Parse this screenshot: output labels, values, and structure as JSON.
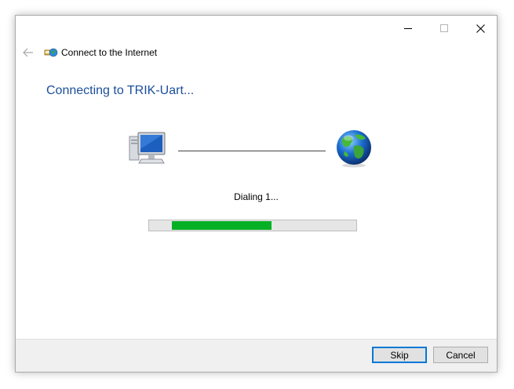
{
  "window": {
    "title": "Connect to the Internet",
    "heading": "Connecting to TRIK-Uart..."
  },
  "caption_buttons": {
    "minimize_icon": "minimize-icon",
    "maximize_icon": "maximize-icon",
    "close_icon": "close-icon"
  },
  "status": {
    "text": "Dialing 1...",
    "progress_start_fraction": 0.11,
    "progress_end_fraction": 0.59,
    "progress_color": "#06b025"
  },
  "buttons": {
    "skip": "Skip",
    "cancel": "Cancel"
  },
  "colors": {
    "heading": "#1b4f9c",
    "default_button_border": "#0078d7"
  }
}
